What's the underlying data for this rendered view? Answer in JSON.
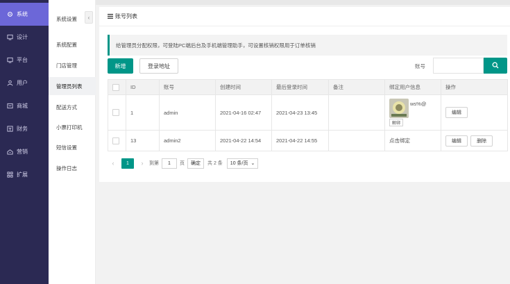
{
  "nav": {
    "items": [
      {
        "label": "系统",
        "icon": "gear-icon"
      },
      {
        "label": "设计",
        "icon": "monitor-icon"
      },
      {
        "label": "平台",
        "icon": "monitor-icon"
      },
      {
        "label": "用户",
        "icon": "user-icon"
      },
      {
        "label": "商城",
        "icon": "shop-icon"
      },
      {
        "label": "财务",
        "icon": "finance-icon"
      },
      {
        "label": "营销",
        "icon": "marketing-icon"
      },
      {
        "label": "扩展",
        "icon": "grid-icon"
      }
    ],
    "active_index": 0,
    "active_color": "#6c67d8",
    "bg_color": "#2b2953"
  },
  "submenu": {
    "items": [
      "系统设置",
      "系统配置",
      "门店管理",
      "管理员列表",
      "配送方式",
      "小票打印机",
      "短信设置",
      "操作日志"
    ],
    "active_index": 3,
    "collapse_icon": "chevron-left-icon"
  },
  "page": {
    "title": "账号列表",
    "title_icon": "list-icon",
    "tip": "给管理员分配权限，可登陆PC端后台及手机端管理助手，可设置核销权限用于订单核销",
    "accent_color": "#009688"
  },
  "toolbar": {
    "add_label": "新增",
    "login_url_label": "登录地址",
    "search_label": "账号",
    "search_value": "",
    "search_icon": "search-icon"
  },
  "table": {
    "headers": [
      "",
      "ID",
      "账号",
      "创建时间",
      "最后登录时间",
      "备注",
      "绑定用户信息",
      "操作"
    ],
    "rows": [
      {
        "id": "1",
        "account": "admin",
        "created": "2021-04-16 02:47",
        "last_login": "2021-04-23 13:45",
        "note": "",
        "bind_name": "ws%@",
        "unbind_label": "解绑",
        "bind_text": "",
        "actions": [
          "编辑"
        ]
      },
      {
        "id": "13",
        "account": "admin2",
        "created": "2021-04-22 14:54",
        "last_login": "2021-04-22 14:55",
        "note": "",
        "bind_name": "",
        "unbind_label": "",
        "bind_text": "点击绑定",
        "actions": [
          "编辑",
          "删除"
        ]
      }
    ]
  },
  "pager": {
    "current": "1",
    "goto_label": "到第",
    "page_input": "1",
    "page_unit": "页",
    "confirm_label": "确定",
    "total": "共 2 条",
    "page_size": "10 条/页"
  }
}
